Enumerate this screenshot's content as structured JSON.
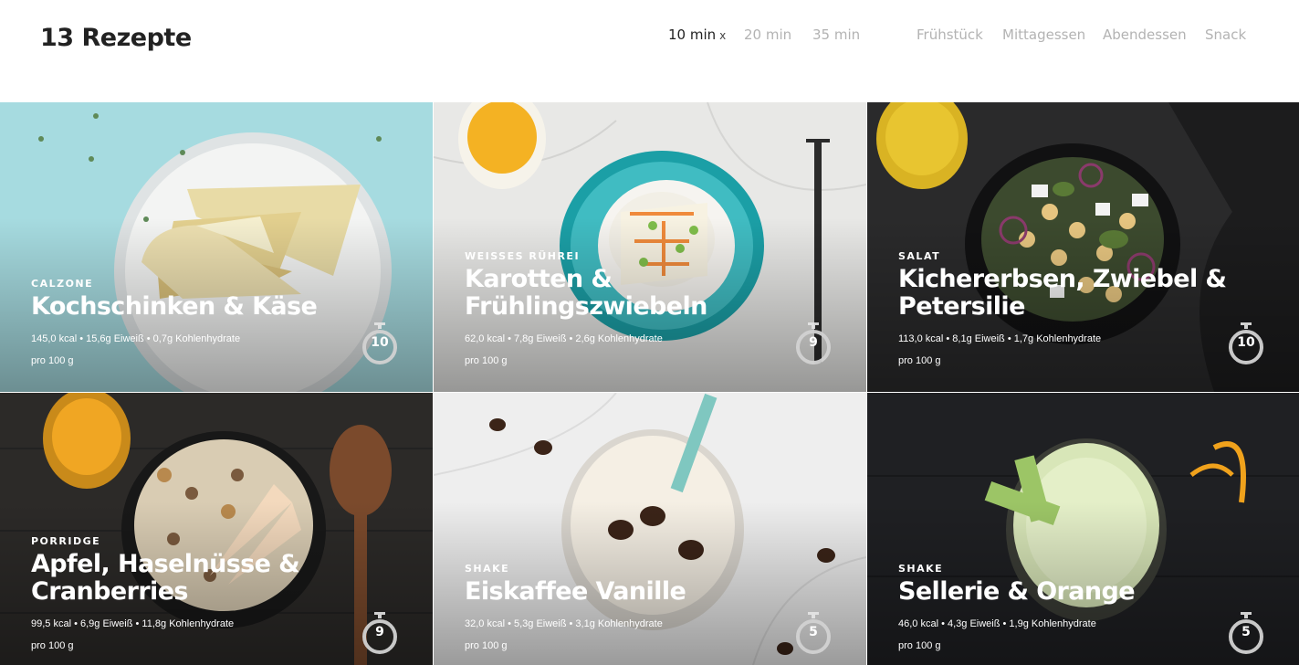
{
  "header": {
    "title": "13 Rezepte",
    "time_filters": [
      {
        "label": "10 min",
        "active": true,
        "clear": "x"
      },
      {
        "label": "20 min",
        "active": false
      },
      {
        "label": "35 min",
        "active": false
      }
    ],
    "meal_filters": [
      {
        "label": "Frühstück"
      },
      {
        "label": "Mittagessen"
      },
      {
        "label": "Abendessen"
      },
      {
        "label": "Snack"
      }
    ]
  },
  "recipes": [
    {
      "category": "Calzone",
      "name_lines": [
        "Kochschinken & Käse"
      ],
      "nutrition": "145,0 kcal • 15,6g Eiweiß • 0,7g Kohlenhydrate",
      "per": "pro 100 g",
      "minutes": "10"
    },
    {
      "category": "Weisses Rührei",
      "name_lines": [
        "Karotten &",
        "Frühlingszwiebeln"
      ],
      "nutrition": "62,0 kcal • 7,8g Eiweiß • 2,6g Kohlenhydrate",
      "per": "pro 100 g",
      "minutes": "9"
    },
    {
      "category": "Salat",
      "name_lines": [
        "Kichererbsen, Zwiebel &",
        "Petersilie"
      ],
      "nutrition": "113,0 kcal • 8,1g Eiweiß • 1,7g Kohlenhydrate",
      "per": "pro 100 g",
      "minutes": "10"
    },
    {
      "category": "Porridge",
      "name_lines": [
        "Apfel, Haselnüsse &",
        "Cranberries"
      ],
      "nutrition": "99,5 kcal • 6,9g Eiweiß • 11,8g Kohlenhydrate",
      "per": "pro 100 g",
      "minutes": "9"
    },
    {
      "category": "Shake",
      "name_lines": [
        "Eiskaffee Vanille"
      ],
      "nutrition": "32,0 kcal • 5,3g Eiweiß • 3,1g Kohlenhydrate",
      "per": "pro 100 g",
      "minutes": "5"
    },
    {
      "category": "Shake",
      "name_lines": [
        "Sellerie & Orange"
      ],
      "nutrition": "46,0 kcal • 4,3g Eiweiß • 1,9g Kohlenhydrate",
      "per": "pro 100 g",
      "minutes": "5"
    }
  ]
}
